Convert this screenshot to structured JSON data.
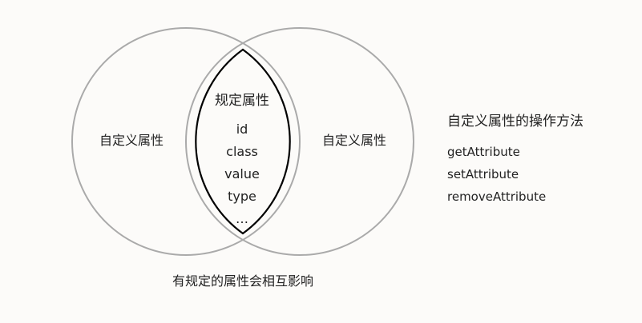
{
  "diagram": {
    "left_label": "自定义属性",
    "right_label": "自定义属性",
    "intersection_title": "规定属性",
    "intersection_items": [
      "id",
      "class",
      "value",
      "type",
      "…"
    ],
    "bottom_caption": "有规定的属性会相互影响"
  },
  "operations": {
    "title": "自定义属性的操作方法",
    "items": [
      "getAttribute",
      "setAttribute",
      "removeAttribute"
    ]
  }
}
